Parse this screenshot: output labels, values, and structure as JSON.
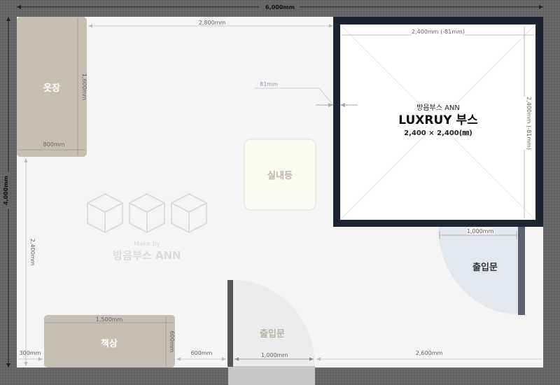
{
  "dimensions": {
    "total_width": "6,000mm",
    "total_height": "4,000mm",
    "wardrobe_to_booth": "2,800mm",
    "wardrobe_height": "1,600mm",
    "wardrobe_width": "800mm",
    "left_lower": "2,400mm",
    "desk_width": "1,500mm",
    "desk_depth": "600mm",
    "desk_left_gap": "300mm",
    "desk_to_door": "600mm",
    "bottom_door_width": "1,000mm",
    "right_bottom": "2,600mm",
    "booth_gap": "81mm",
    "booth_inner_width": "2,400mm (-81mm)",
    "booth_inner_height": "2,400mm (-81mm)",
    "right_door_width": "1,000mm"
  },
  "labels": {
    "wardrobe": "옷장",
    "desk": "책상",
    "ceiling_light": "실내등",
    "door_right": "출입문",
    "door_bottom": "출입문"
  },
  "booth": {
    "brand": "방음부스 ANN",
    "model": "LUXRUY 부스",
    "size": "2,400 × 2,400(㎜)"
  },
  "watermark": {
    "line1": "Make by",
    "line2": "방음부스 ANN"
  },
  "colors": {
    "outer_wall": "#666666",
    "floor": "#f5f5f5",
    "furniture": "#c8bfb3",
    "booth_frame": "#1c2333",
    "door_swing": "#e3e7ee",
    "door_panel": "#5a6270"
  }
}
